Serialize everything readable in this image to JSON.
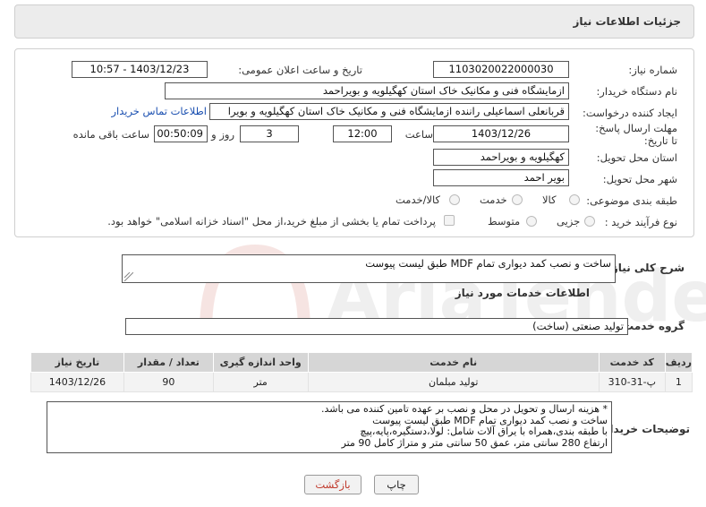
{
  "header": {
    "title": "جزئیات اطلاعات نیاز"
  },
  "form": {
    "need_number_label": "شماره نیاز:",
    "need_number": "1103020022000030",
    "announce_label": "تاریخ و ساعت اعلان عمومی:",
    "announce_value": "1403/12/23 - 10:57",
    "buyer_org_label": "نام دستگاه خریدار:",
    "buyer_org": "ازمایشگاه فنی و مکانیک خاک استان کهگیلویه و بویراحمد",
    "requester_label": "ایجاد کننده درخواست:",
    "requester": "قربانعلی اسماعیلی راننده ازمایشگاه فنی و مکانیک خاک استان کهگیلویه و بویرا",
    "contact_link": "اطلاعات تماس خریدار",
    "deadline_label": "مهلت ارسال پاسخ: تا تاریخ:",
    "deadline_date": "1403/12/26",
    "time_label": "ساعت",
    "deadline_time": "12:00",
    "days_value": "3",
    "days_label": "روز و",
    "remaining_time": "00:50:09",
    "remaining_label": "ساعت باقی مانده",
    "province_label": "استان محل تحویل:",
    "province": "کهگیلویه و بویراحمد",
    "city_label": "شهر محل تحویل:",
    "city": "بویر احمد",
    "category_label": "طبقه بندی موضوعی:",
    "category_options": [
      "کالا",
      "خدمت",
      "کالا/خدمت"
    ],
    "process_label": "نوع فرآیند خرید :",
    "process_options": [
      "جزیی",
      "متوسط"
    ],
    "payment_note": "پرداخت تمام یا بخشی از مبلغ خرید،از محل \"اسناد خزانه اسلامی\" خواهد بود."
  },
  "description": {
    "label": "شرح کلی نیاز:",
    "value": "ساخت و نصب کمد دیواری تمام MDF طبق لیست پیوست"
  },
  "services": {
    "section_title": "اطلاعات خدمات مورد نیاز",
    "group_label": "گروه خدمت:",
    "group_value": "تولید صنعتی (ساخت)"
  },
  "table": {
    "headers": [
      "ردیف",
      "کد خدمت",
      "نام خدمت",
      "واحد اندازه گیری",
      "تعداد / مقدار",
      "تاریخ نیاز"
    ],
    "rows": [
      [
        "1",
        "پ-31-310",
        "تولید مبلمان",
        "متر",
        "90",
        "1403/12/26"
      ]
    ]
  },
  "buyer_notes": {
    "label": "توضیحات خریدار:",
    "lines": [
      "* هزینه ارسال و تحویل در محل و نصب بر عهده تامین کننده می باشد.",
      "ساخت و نصب کمد دیواری تمام MDF طبق لیست پیوست",
      "با طبقه بندی،همراه با یراق آلات شامل: لولا،دستگیره،پایه،پیچ",
      "ارتفاع 280 سانتی متر، عمق 50 سانتی متر و متراژ کامل 90 متر"
    ]
  },
  "buttons": {
    "print": "چاپ",
    "back": "بازگشت"
  },
  "watermark": {
    "text": "AriaTender.neT"
  },
  "colors": {
    "link": "#1a4fb0",
    "back_button": "#c0392b",
    "header_bg": "#ececec",
    "table_header": "#d6d6d6"
  }
}
